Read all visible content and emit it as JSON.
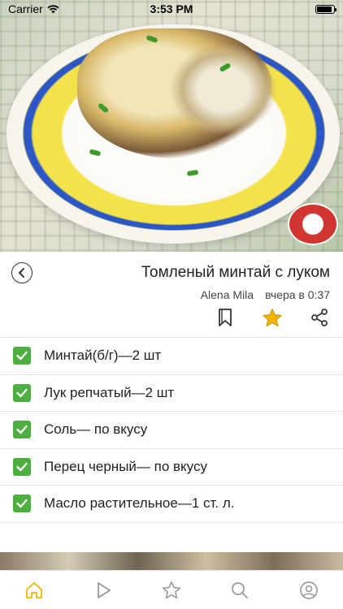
{
  "status_bar": {
    "carrier": "Carrier",
    "time": "3:53 PM"
  },
  "recipe": {
    "title": "Томленый минтай с луком",
    "author": "Alena Mila",
    "date": "вчера в 0:37"
  },
  "actions": {
    "bookmark_icon": "bookmark-icon",
    "favorite_icon": "star-icon",
    "share_icon": "share-icon"
  },
  "ingredients": [
    {
      "text": "Минтай(б/г)—2 шт",
      "checked": true
    },
    {
      "text": "Лук репчатый—2 шт",
      "checked": true
    },
    {
      "text": "Соль— по вкусу",
      "checked": true
    },
    {
      "text": "Перец черный— по вкусу",
      "checked": true
    },
    {
      "text": "Масло растительное—1 ст. л.",
      "checked": true
    }
  ],
  "tab_bar": {
    "tabs": [
      "home-icon",
      "video-icon",
      "favorites-icon",
      "search-icon",
      "profile-icon"
    ],
    "active": "home-icon"
  },
  "colors": {
    "accent_yellow": "#f0b400",
    "check_green": "#4caf3f",
    "tab_inactive": "#9a9a9a"
  }
}
